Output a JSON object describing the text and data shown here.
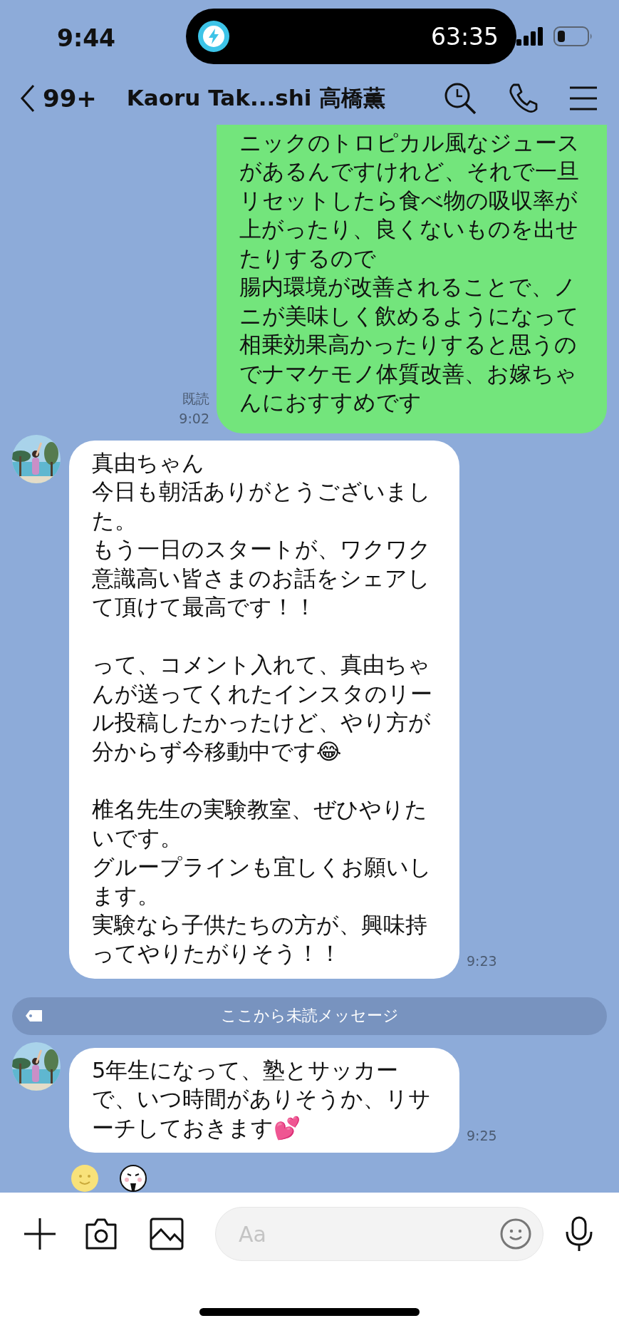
{
  "status_bar": {
    "time": "9:44",
    "timer": "63:35"
  },
  "header": {
    "back_count": "99+",
    "title": "Kaoru Tak...shi 高橋薫"
  },
  "messages": [
    {
      "kind": "outgoing",
      "blocks": [
        [
          "ニックのトロピカル風なジュースがあるんですけれど、それで一旦リセットしたら食べ物の吸収率が上がったり、良くないものを出せたりするので",
          "腸内環境が改善されることで、ノニが美味しく飲めるようになって相乗効果高かったりすると思うのでナマケモノ体質改善、お嫁ちゃんにおすすめです"
        ]
      ],
      "read_label": "既読",
      "time": "9:02"
    },
    {
      "kind": "incoming",
      "blocks": [
        [
          "真由ちゃん",
          "今日も朝活ありがとうございました。",
          "もう一日のスタートが、ワクワク意識高い皆さまのお話をシェアして頂けて最高です！！"
        ],
        [
          "って、コメント入れて、真由ちゃんが送ってくれたインスタのリール投稿したかったけど、やり方が分からず今移動中です😂"
        ],
        [
          "椎名先生の実験教室、ぜひやりたいです。",
          "グループラインも宜しくお願いします。",
          "実験なら子供たちの方が、興味持ってやりたがりそう！！"
        ]
      ],
      "time": "9:23"
    },
    {
      "kind": "unread_divider",
      "text": "ここから未読メッセージ"
    },
    {
      "kind": "incoming",
      "blocks": [
        [
          "5年生になって、塾とサッカーで、いつ時間がありそうか、リサーチしておきます💕"
        ]
      ],
      "time": "9:25"
    }
  ],
  "composer": {
    "placeholder": "Aa"
  }
}
